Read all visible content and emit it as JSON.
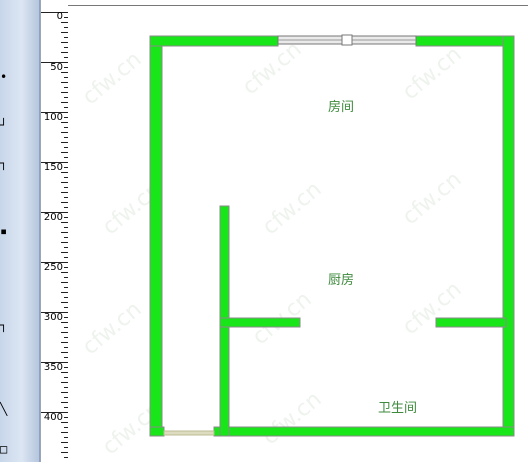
{
  "toolbar": {
    "tools": [
      {
        "glyph": "•",
        "icon": "dot-tool-icon"
      },
      {
        "glyph": "┘",
        "icon": "corner-tool-icon"
      },
      {
        "glyph": "┐",
        "icon": "wall-corner-tool-icon"
      },
      {
        "glyph": "▪",
        "icon": "point-tool-icon"
      },
      {
        "glyph": "┐",
        "icon": "angle-tool-icon"
      },
      {
        "glyph": "╲",
        "icon": "line-tool-icon"
      },
      {
        "glyph": "□",
        "icon": "box-tool-icon"
      }
    ]
  },
  "ruler": {
    "top_zero": "0",
    "vertical_labels": [
      "0",
      "50",
      "100",
      "150",
      "200",
      "250",
      "300",
      "350",
      "400"
    ]
  },
  "floorplan": {
    "wall_color": "#19e619",
    "wall_outline": "#8a8a8a",
    "rooms": {
      "room": "房间",
      "kitchen": "厨房",
      "bathroom": "卫生间"
    }
  },
  "watermark": "cfw.cn"
}
